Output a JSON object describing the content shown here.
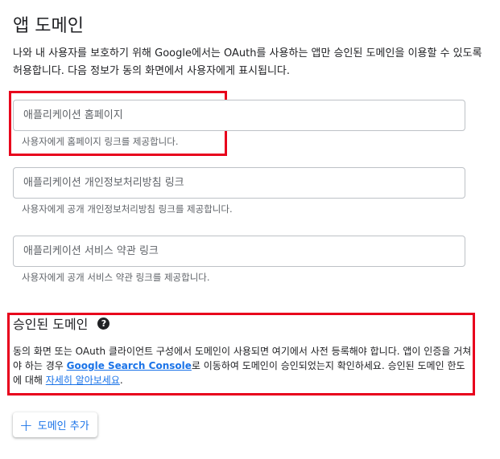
{
  "page": {
    "title": "앱 도메인",
    "intro": "나와 내 사용자를 보호하기 위해 Google에서는 OAuth를 사용하는 앱만 승인된 도메인을 이용할 수 있도록 허용합니다. 다음 정보가 동의 화면에서 사용자에게 표시됩니다."
  },
  "fields": [
    {
      "placeholder": "애플리케이션 홈페이지",
      "value": "",
      "hint": "사용자에게 홈페이지 링크를 제공합니다."
    },
    {
      "placeholder": "애플리케이션 개인정보처리방침 링크",
      "value": "",
      "hint": "사용자에게 공개 개인정보처리방침 링크를 제공합니다."
    },
    {
      "placeholder": "애플리케이션 서비스 약관 링크",
      "value": "",
      "hint": "사용자에게 공개 서비스 약관 링크를 제공합니다."
    }
  ],
  "authorized_domains": {
    "title": "승인된 도메인",
    "help_icon": "help-circle-icon",
    "desc_part1": "동의 화면 또는 OAuth 클라이언트 구성에서 도메인이 사용되면 여기에서 사전 등록해야 합니다. 앱이 인증을 거쳐야 하는 경우 ",
    "link_console": "Google Search Console",
    "desc_part2": "로 이동하여 도메인이 승인되었는지 확인하세요. 승인된 도메인 한도에 대해 ",
    "link_learn": "자세히 알아보세요",
    "desc_part3": ".",
    "add_button": "도메인 추가"
  },
  "colors": {
    "accent": "#1a73e8",
    "highlight_border": "#e8001c",
    "text": "#202124",
    "secondary_text": "#5f6368"
  }
}
